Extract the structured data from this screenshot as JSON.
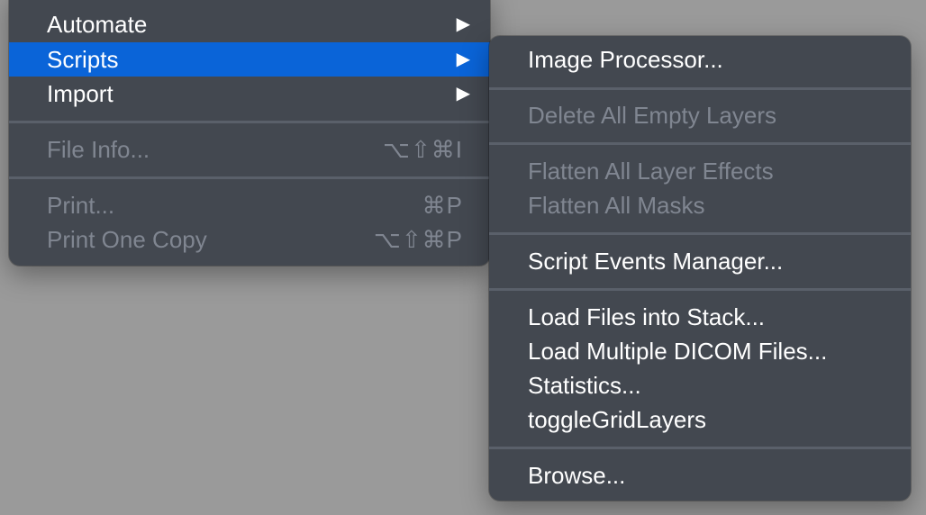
{
  "main_menu": {
    "items": [
      {
        "label": "Automate",
        "arrow": "▶"
      },
      {
        "label": "Scripts",
        "arrow": "▶"
      },
      {
        "label": "Import",
        "arrow": "▶"
      },
      {
        "label": "File Info...",
        "shortcut": "⌥⇧⌘I",
        "disabled": true
      },
      {
        "label": "Print...",
        "shortcut": "⌘P",
        "disabled": true
      },
      {
        "label": "Print One Copy",
        "shortcut": "⌥⇧⌘P",
        "disabled": true
      }
    ],
    "highlighted": "Scripts"
  },
  "scripts_submenu": {
    "items": [
      {
        "label": "Image Processor..."
      },
      {
        "label": "Delete All Empty Layers",
        "disabled": true
      },
      {
        "label": "Flatten All Layer Effects",
        "disabled": true
      },
      {
        "label": "Flatten All Masks",
        "disabled": true
      },
      {
        "label": "Script Events Manager..."
      },
      {
        "label": "Load Files into Stack..."
      },
      {
        "label": "Load Multiple DICOM Files..."
      },
      {
        "label": "Statistics..."
      },
      {
        "label": "toggleGridLayers"
      },
      {
        "label": "Browse..."
      }
    ]
  },
  "colors": {
    "menu_background": "#434850",
    "highlight": "#0a64d8",
    "disabled_text": "#808691",
    "desktop_background": "#9a9a9a"
  }
}
